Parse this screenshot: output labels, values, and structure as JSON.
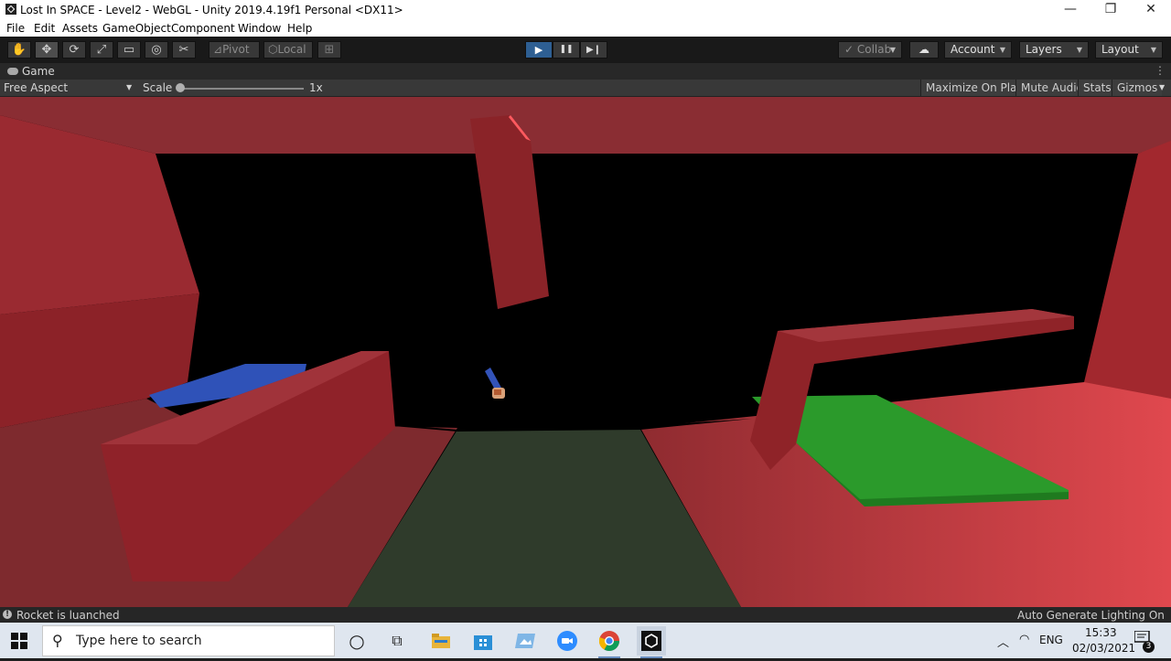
{
  "window": {
    "title": "Lost In SPACE - Level2 - WebGL - Unity 2019.4.19f1 Personal <DX11>",
    "minimize_glyph": "—",
    "restore_glyph": "❐",
    "close_glyph": "✕"
  },
  "menu": [
    "File",
    "Edit",
    "Assets",
    "GameObject",
    "Component",
    "Window",
    "Help"
  ],
  "toolbar": {
    "tools": [
      {
        "name": "hand-tool-icon",
        "glyph": "✋"
      },
      {
        "name": "move-tool-icon",
        "glyph": "✥"
      },
      {
        "name": "rotate-tool-icon",
        "glyph": "⟳"
      },
      {
        "name": "scale-tool-icon",
        "glyph": "⤢"
      },
      {
        "name": "rect-tool-icon",
        "glyph": "▭"
      },
      {
        "name": "transform-tool-icon",
        "glyph": "◎"
      },
      {
        "name": "custom-tool-icon",
        "glyph": "✂"
      }
    ],
    "pivot_label": "Pivot",
    "local_label": "Local",
    "grid_glyph": "⊞",
    "play_glyph": "▶",
    "pause_glyph": "❚❚",
    "step_glyph": "▶❙",
    "collab_label": "Collab",
    "cloud_glyph": "☁",
    "account_label": "Account",
    "layers_label": "Layers",
    "layout_label": "Layout"
  },
  "game_view": {
    "tab_label": "Game",
    "aspect_label": "Free Aspect",
    "scale_label": "Scale",
    "scale_value": "1x",
    "buttons": [
      "Maximize On Play",
      "Mute Audio",
      "Stats",
      "Gizmos"
    ]
  },
  "status": {
    "message": "Rocket is luanched",
    "right": "Auto Generate Lighting On"
  },
  "taskbar": {
    "search_placeholder": "Type here to search",
    "lang": "ENG",
    "time": "15:33",
    "date": "02/03/2021",
    "notification_count": "3"
  },
  "colors": {
    "play_active": "#2e5f93",
    "wall_red": "#8a2a30",
    "floor_green": "#2f3b2b",
    "pad_green": "#2b9a2b",
    "pad_blue": "#2f52b8"
  }
}
